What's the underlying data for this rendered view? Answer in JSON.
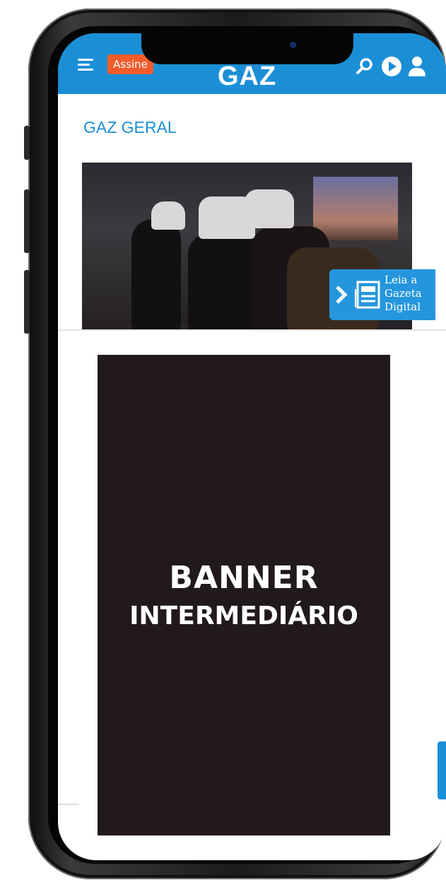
{
  "header": {
    "assine_label": "Assine",
    "logo_text": "GAZ",
    "colors": {
      "bar": "#1b8fd6",
      "assine": "#f25c2a"
    }
  },
  "section": {
    "title": "GAZ GERAL"
  },
  "leia": {
    "line1": "Leia a",
    "line2": "Gazeta",
    "line3": "Digital"
  },
  "banner": {
    "line1": "BANNER",
    "line2": "INTERMEDIÁRIO",
    "background": "#221a1a"
  }
}
